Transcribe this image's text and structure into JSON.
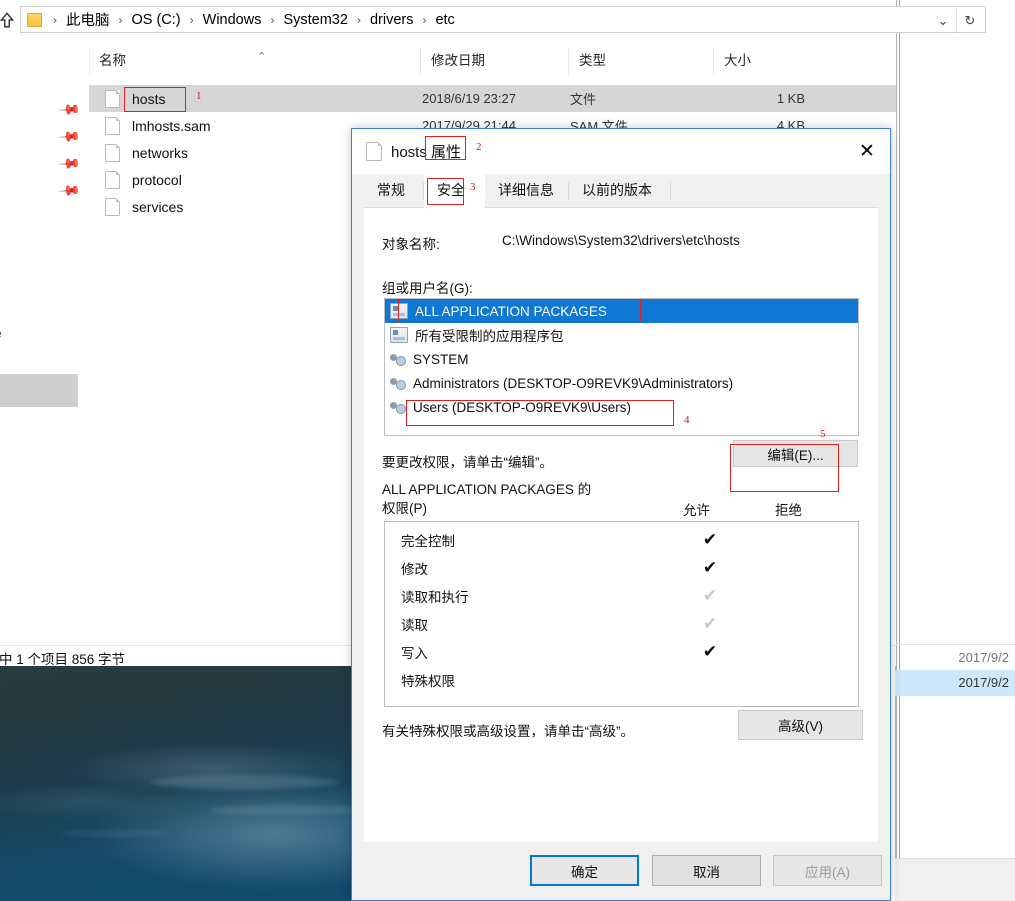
{
  "explorer": {
    "address": {
      "crumbs": [
        "此电脑",
        "OS (C:)",
        "Windows",
        "System32",
        "drivers",
        "etc"
      ],
      "separator": "›",
      "dropdown_icon": "chevron-down-icon",
      "refresh_icon": "refresh-icon",
      "up_icon": "up-arrow-icon",
      "folder_icon": "folder-icon"
    },
    "columns": [
      "名称",
      "修改日期",
      "类型",
      "大小"
    ],
    "sort_caret": "⌃",
    "files": [
      {
        "name": "hosts",
        "date": "2018/6/19 23:27",
        "type": "文件",
        "size": "1 KB",
        "selected": true
      },
      {
        "name": "lmhosts.sam",
        "date": "2017/9/29 21:44",
        "type": "SAM 文件",
        "size": "4 KB",
        "selected": false
      },
      {
        "name": "networks",
        "date": "",
        "type": "",
        "size": "",
        "selected": false
      },
      {
        "name": "protocol",
        "date": "",
        "type": "",
        "size": "",
        "selected": false
      },
      {
        "name": "services",
        "date": "",
        "type": "",
        "size": "",
        "selected": false
      }
    ],
    "nav_truncated_item": "e",
    "status": "中 1 个项目  856 字节"
  },
  "background_window": {
    "row_a": "2017/9/2",
    "row_b": "2017/9/2"
  },
  "dialog": {
    "title": "hosts 属性",
    "title_plain": "hosts",
    "title_highlight": "属性",
    "close_icon": "close-icon",
    "file_icon": "file-icon",
    "tabs": [
      {
        "label": "常规",
        "active": false
      },
      {
        "label": "安全",
        "active": true
      },
      {
        "label": "详细信息",
        "active": false
      },
      {
        "label": "以前的版本",
        "active": false
      }
    ],
    "object_name_label": "对象名称:",
    "object_name_value": "C:\\Windows\\System32\\drivers\\etc\\hosts",
    "group_label": "组或用户名(G):",
    "groups": [
      {
        "name": "ALL APPLICATION PACKAGES",
        "icon": "package-icon",
        "selected": true
      },
      {
        "name": "所有受限制的应用程序包",
        "icon": "package-icon",
        "selected": false
      },
      {
        "name": "SYSTEM",
        "icon": "users-icon",
        "selected": false
      },
      {
        "name": "Administrators (DESKTOP-O9REVK9\\Administrators)",
        "icon": "users-icon",
        "selected": false
      },
      {
        "name": "Users (DESKTOP-O9REVK9\\Users)",
        "icon": "users-icon",
        "selected": false
      }
    ],
    "hint_change": "要更改权限，请单击“编辑”。",
    "edit_button": "编辑(E)...",
    "permissions_title": "ALL APPLICATION PACKAGES 的\n权限(P)",
    "col_allow": "允许",
    "col_deny": "拒绝",
    "permissions": [
      {
        "name": "完全控制",
        "allow": "checked",
        "deny": "none"
      },
      {
        "name": "修改",
        "allow": "checked",
        "deny": "none"
      },
      {
        "name": "读取和执行",
        "allow": "dimmed",
        "deny": "none"
      },
      {
        "name": "读取",
        "allow": "dimmed",
        "deny": "none"
      },
      {
        "name": "写入",
        "allow": "checked",
        "deny": "none"
      },
      {
        "name": "特殊权限",
        "allow": "none",
        "deny": "none"
      }
    ],
    "hint_advanced": "有关特殊权限或高级设置，请单击“高级”。",
    "advanced_button": "高级(V)",
    "footer": {
      "ok": "确定",
      "cancel": "取消",
      "apply": "应用(A)"
    }
  },
  "annotations": [
    {
      "num": "1",
      "target": "hosts-file-name"
    },
    {
      "num": "2",
      "target": "dialog-title-properties"
    },
    {
      "num": "3",
      "target": "security-tab"
    },
    {
      "num": "4",
      "target": "users-group-entry"
    },
    {
      "num": "5",
      "target": "edit-button"
    }
  ],
  "colors": {
    "selection_blue": "#1077d4",
    "annotation_red": "#e02020",
    "focus_blue": "#0078d7",
    "row_selected_gray": "#d6d6d6"
  }
}
